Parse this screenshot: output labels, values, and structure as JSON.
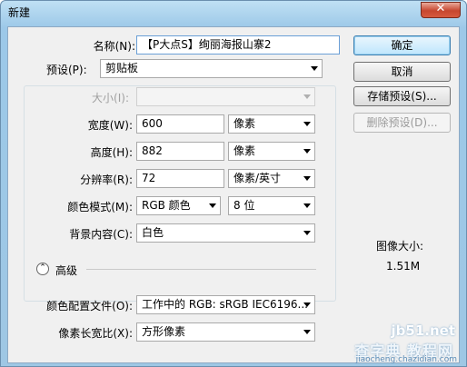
{
  "window": {
    "title": "新建",
    "close_glyph": "✕"
  },
  "form": {
    "name_label": "名称(N):",
    "name_value": "【P大点S】绚丽海报山寨2",
    "preset_label": "预设(P):",
    "preset_value": "剪贴板",
    "size_label": "大小(I):",
    "size_value": "",
    "width_label": "宽度(W):",
    "width_value": "600",
    "width_unit": "像素",
    "height_label": "高度(H):",
    "height_value": "882",
    "height_unit": "像素",
    "resolution_label": "分辨率(R):",
    "resolution_value": "72",
    "resolution_unit": "像素/英寸",
    "color_mode_label": "颜色模式(M):",
    "color_mode_value": "RGB 颜色",
    "bit_depth_value": "8 位",
    "background_label": "背景内容(C):",
    "background_value": "白色",
    "advanced_label": "高级",
    "advanced_icon": "double-chevron-up-icon",
    "color_profile_label": "颜色配置文件(O):",
    "color_profile_value": "工作中的 RGB: sRGB IEC6196...",
    "pixel_aspect_label": "像素长宽比(X):",
    "pixel_aspect_value": "方形像素"
  },
  "buttons": {
    "ok": "确定",
    "cancel": "取消",
    "save_preset": "存储预设(S)...",
    "delete_preset": "删除预设(D)..."
  },
  "info": {
    "image_size_label": "图像大小:",
    "image_size_value": "1.51M"
  },
  "watermark": {
    "line1": "jb51.net",
    "line2": "查字典 教程网",
    "line3": "jiaocheng.chazidian.com"
  }
}
